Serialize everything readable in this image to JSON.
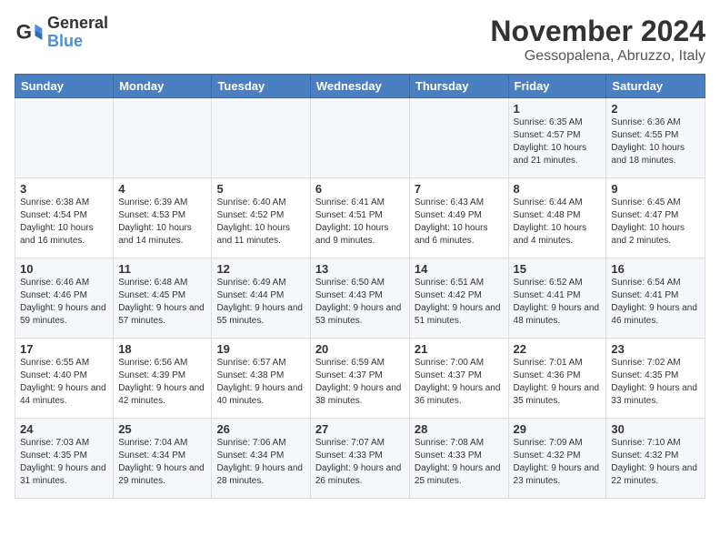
{
  "logo": {
    "line1": "General",
    "line2": "Blue"
  },
  "title": "November 2024",
  "subtitle": "Gessopalena, Abruzzo, Italy",
  "weekdays": [
    "Sunday",
    "Monday",
    "Tuesday",
    "Wednesday",
    "Thursday",
    "Friday",
    "Saturday"
  ],
  "weeks": [
    [
      {
        "day": "",
        "info": ""
      },
      {
        "day": "",
        "info": ""
      },
      {
        "day": "",
        "info": ""
      },
      {
        "day": "",
        "info": ""
      },
      {
        "day": "",
        "info": ""
      },
      {
        "day": "1",
        "info": "Sunrise: 6:35 AM\nSunset: 4:57 PM\nDaylight: 10 hours and 21 minutes."
      },
      {
        "day": "2",
        "info": "Sunrise: 6:36 AM\nSunset: 4:55 PM\nDaylight: 10 hours and 18 minutes."
      }
    ],
    [
      {
        "day": "3",
        "info": "Sunrise: 6:38 AM\nSunset: 4:54 PM\nDaylight: 10 hours and 16 minutes."
      },
      {
        "day": "4",
        "info": "Sunrise: 6:39 AM\nSunset: 4:53 PM\nDaylight: 10 hours and 14 minutes."
      },
      {
        "day": "5",
        "info": "Sunrise: 6:40 AM\nSunset: 4:52 PM\nDaylight: 10 hours and 11 minutes."
      },
      {
        "day": "6",
        "info": "Sunrise: 6:41 AM\nSunset: 4:51 PM\nDaylight: 10 hours and 9 minutes."
      },
      {
        "day": "7",
        "info": "Sunrise: 6:43 AM\nSunset: 4:49 PM\nDaylight: 10 hours and 6 minutes."
      },
      {
        "day": "8",
        "info": "Sunrise: 6:44 AM\nSunset: 4:48 PM\nDaylight: 10 hours and 4 minutes."
      },
      {
        "day": "9",
        "info": "Sunrise: 6:45 AM\nSunset: 4:47 PM\nDaylight: 10 hours and 2 minutes."
      }
    ],
    [
      {
        "day": "10",
        "info": "Sunrise: 6:46 AM\nSunset: 4:46 PM\nDaylight: 9 hours and 59 minutes."
      },
      {
        "day": "11",
        "info": "Sunrise: 6:48 AM\nSunset: 4:45 PM\nDaylight: 9 hours and 57 minutes."
      },
      {
        "day": "12",
        "info": "Sunrise: 6:49 AM\nSunset: 4:44 PM\nDaylight: 9 hours and 55 minutes."
      },
      {
        "day": "13",
        "info": "Sunrise: 6:50 AM\nSunset: 4:43 PM\nDaylight: 9 hours and 53 minutes."
      },
      {
        "day": "14",
        "info": "Sunrise: 6:51 AM\nSunset: 4:42 PM\nDaylight: 9 hours and 51 minutes."
      },
      {
        "day": "15",
        "info": "Sunrise: 6:52 AM\nSunset: 4:41 PM\nDaylight: 9 hours and 48 minutes."
      },
      {
        "day": "16",
        "info": "Sunrise: 6:54 AM\nSunset: 4:41 PM\nDaylight: 9 hours and 46 minutes."
      }
    ],
    [
      {
        "day": "17",
        "info": "Sunrise: 6:55 AM\nSunset: 4:40 PM\nDaylight: 9 hours and 44 minutes."
      },
      {
        "day": "18",
        "info": "Sunrise: 6:56 AM\nSunset: 4:39 PM\nDaylight: 9 hours and 42 minutes."
      },
      {
        "day": "19",
        "info": "Sunrise: 6:57 AM\nSunset: 4:38 PM\nDaylight: 9 hours and 40 minutes."
      },
      {
        "day": "20",
        "info": "Sunrise: 6:59 AM\nSunset: 4:37 PM\nDaylight: 9 hours and 38 minutes."
      },
      {
        "day": "21",
        "info": "Sunrise: 7:00 AM\nSunset: 4:37 PM\nDaylight: 9 hours and 36 minutes."
      },
      {
        "day": "22",
        "info": "Sunrise: 7:01 AM\nSunset: 4:36 PM\nDaylight: 9 hours and 35 minutes."
      },
      {
        "day": "23",
        "info": "Sunrise: 7:02 AM\nSunset: 4:35 PM\nDaylight: 9 hours and 33 minutes."
      }
    ],
    [
      {
        "day": "24",
        "info": "Sunrise: 7:03 AM\nSunset: 4:35 PM\nDaylight: 9 hours and 31 minutes."
      },
      {
        "day": "25",
        "info": "Sunrise: 7:04 AM\nSunset: 4:34 PM\nDaylight: 9 hours and 29 minutes."
      },
      {
        "day": "26",
        "info": "Sunrise: 7:06 AM\nSunset: 4:34 PM\nDaylight: 9 hours and 28 minutes."
      },
      {
        "day": "27",
        "info": "Sunrise: 7:07 AM\nSunset: 4:33 PM\nDaylight: 9 hours and 26 minutes."
      },
      {
        "day": "28",
        "info": "Sunrise: 7:08 AM\nSunset: 4:33 PM\nDaylight: 9 hours and 25 minutes."
      },
      {
        "day": "29",
        "info": "Sunrise: 7:09 AM\nSunset: 4:32 PM\nDaylight: 9 hours and 23 minutes."
      },
      {
        "day": "30",
        "info": "Sunrise: 7:10 AM\nSunset: 4:32 PM\nDaylight: 9 hours and 22 minutes."
      }
    ]
  ]
}
